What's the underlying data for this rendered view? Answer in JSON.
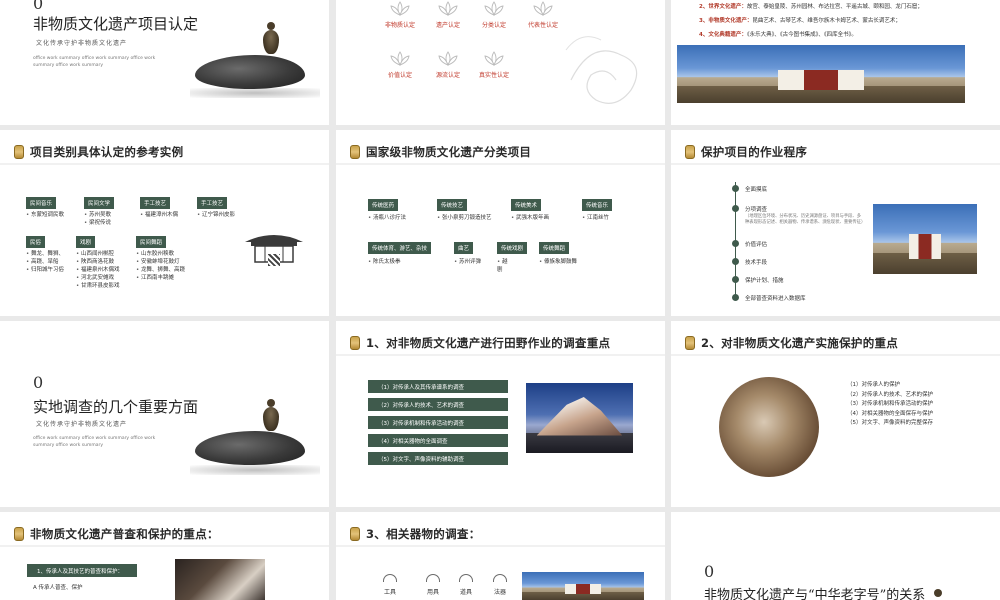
{
  "slides": {
    "s1": {
      "num": "0",
      "title": "非物质文化遗产项目认定",
      "subtitle": "文化传承守护非物质文化遗产",
      "small": "office work summary office work summary office work summary office work summary"
    },
    "s2": {
      "labels": [
        "非物质认定",
        "遗产认定",
        "分类认定",
        "代表性认定",
        "价值认定",
        "源流认定",
        "真实性认定"
      ]
    },
    "s3": {
      "lines": [
        {
          "label": "2、世界文化遗产：",
          "text": "故宫、泰始皇陵、苏州园林、布达拉宫、平遥古城、颐和园、龙门石窟；"
        },
        {
          "label": "3、非物质文化遗产：",
          "text": "昆曲艺术、古琴艺术、维吾尔族木卡姆艺术、蒙古长调艺术；"
        },
        {
          "label": "4、文化典籍遗产：",
          "text": "《永乐大典》、《古今图书集成》、《四库全书》。"
        }
      ]
    },
    "s4": {
      "title": "项目类别具体认定的参考实例",
      "groups": [
        {
          "tag": "民间音乐",
          "items": [
            "东蒙短调民歌"
          ]
        },
        {
          "tag": "民间文学",
          "items": [
            "苏州吴歌",
            "梁祝传说"
          ]
        },
        {
          "tag": "手工技艺",
          "items": [
            "福建漳州木偶"
          ]
        },
        {
          "tag": "手工技艺",
          "items": [
            "辽宁锦州皮影"
          ]
        },
        {
          "tag": "民俗",
          "items": [
            "舞龙、舞狮、",
            "高跷、旱船",
            "归阳城午习俗"
          ]
        },
        {
          "tag": "戏剧",
          "items": [
            "山西闻州梆腔",
            "陕西商洛花鼓",
            "福建泉州木偶戏",
            "河北武安傩戏",
            "甘肃环县皮影戏"
          ]
        },
        {
          "tag": "民间舞蹈",
          "items": [
            "山东胶州秧歌",
            "安徽蚌埠花鼓灯",
            "龙舞、狮舞、高跷",
            "江西南丰跳傩"
          ]
        }
      ]
    },
    "s5": {
      "title": "国家级非物质文化遗产分类项目",
      "groups": [
        {
          "tag": "传统医药",
          "items": [
            "汤瓶八诊疗法"
          ]
        },
        {
          "tag": "传统技艺",
          "items": [
            "张小泉剪刀锻造技艺"
          ]
        },
        {
          "tag": "传统美术",
          "items": [
            "武强木版年画"
          ]
        },
        {
          "tag": "传统音乐",
          "items": [
            "江南丝竹"
          ]
        },
        {
          "tag": "传统体育、游艺、杂技",
          "items": [
            "陈氏太极拳"
          ]
        },
        {
          "tag": "曲艺",
          "items": [
            "苏州评弹"
          ]
        },
        {
          "tag": "传统戏剧",
          "items": [
            "越剧"
          ]
        },
        {
          "tag": "传统舞蹈",
          "items": [
            "傣族象脚鼓舞"
          ]
        }
      ]
    },
    "s6": {
      "title": "保护项目的作业程序",
      "steps": [
        "全面摸底",
        "分项调查",
        "价值评估",
        "技术手段",
        "保护计划、措施",
        "全部普查资料进入数据库"
      ],
      "note": "（地理区位环境、分布状况、历史渊源盘证、项目与手段、多种表现形态记述、相关器物、传承谱系、濒危现状、重要传征）"
    },
    "s7": {
      "num": "0",
      "title": "实地调查的几个重要方面",
      "subtitle": "文化传承守护非物质文化遗产",
      "small": "office work summary office work summary office work summary office work summary"
    },
    "s8": {
      "title": "1、对非物质文化遗产进行田野作业的调查重点",
      "bars": [
        "（1）对传承人及其传承谱系的调查",
        "（2）对传承人的技术、艺术的调查",
        "（3）对传承机制和传承活动的调查",
        "（4）对相关器物的全面调查",
        "（5）对文字、声像资料的辅助调查"
      ]
    },
    "s9": {
      "title": "2、对非物质文化遗产实施保护的重点",
      "items": [
        "（1）对传承人的保护",
        "（2）对传承人的技术、艺术的保护",
        "（3）对传承机制和传承活动的保护",
        "（4）对相关器物的全面保存与保护",
        "（5）对文字、声像资料的完整保存"
      ]
    },
    "s10": {
      "title": "非物质文化遗产普查和保护的重点：",
      "bar": "1、传承人及其技艺的普查和保护：",
      "line": "A 传承人普查、保护"
    },
    "s11": {
      "title": "3、相关器物的调查：",
      "items": [
        "工具",
        "用具",
        "道具",
        "法器"
      ]
    },
    "s12": {
      "num": "0",
      "title": "非物质文化遗产与“中华老字号”的关系"
    }
  }
}
